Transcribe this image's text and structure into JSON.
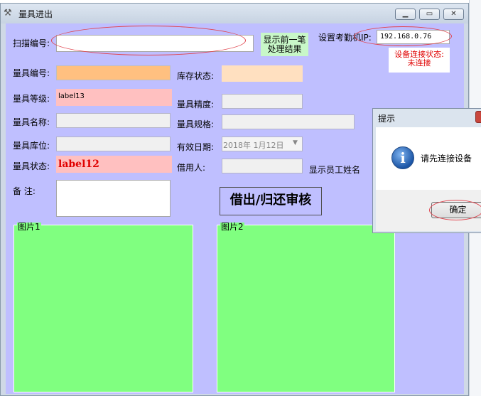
{
  "window": {
    "title": "量具进出"
  },
  "scan": {
    "label": "扫描编号:",
    "value": ""
  },
  "show_prev_button": {
    "line1": "显示前一笔",
    "line2": "处理结果"
  },
  "device_ip": {
    "label": "设置考勤机IP:",
    "value": "192.168.0.76"
  },
  "connection_status": {
    "line1": "设备连接状态:",
    "line2": "未连接"
  },
  "fields": {
    "gauge_no": {
      "label": "量具编号:",
      "value": ""
    },
    "stock_status": {
      "label": "库存状态:",
      "value": ""
    },
    "level": {
      "label": "量具等级:",
      "value": "label13"
    },
    "precision": {
      "label": "量具精度:",
      "value": ""
    },
    "name": {
      "label": "量具名称:",
      "value": ""
    },
    "spec": {
      "label": "量具规格:",
      "value": ""
    },
    "location": {
      "label": "量具库位:",
      "value": ""
    },
    "expiry": {
      "label": "有效日期:",
      "value": "2018年  1月12日"
    },
    "state": {
      "label": "量具状态:",
      "value": "label12"
    },
    "borrower": {
      "label": "借用人:",
      "value": ""
    },
    "employee_name": {
      "label": "显示员工姓名"
    },
    "remark": {
      "label": "备    注:",
      "value": ""
    }
  },
  "audit_button": {
    "label": "借出/归还审核"
  },
  "picture1": {
    "title": "图片1"
  },
  "picture2": {
    "title": "图片2"
  },
  "dialog": {
    "title": "提示",
    "message": "请先连接设备",
    "ok_label": "确定"
  },
  "colors": {
    "client_bg": "#bfbfff",
    "picture_bg": "#80ff80",
    "highlight_orange": "#ffc080",
    "highlight_pink": "#ffc0c0",
    "status_red": "#e00000"
  }
}
